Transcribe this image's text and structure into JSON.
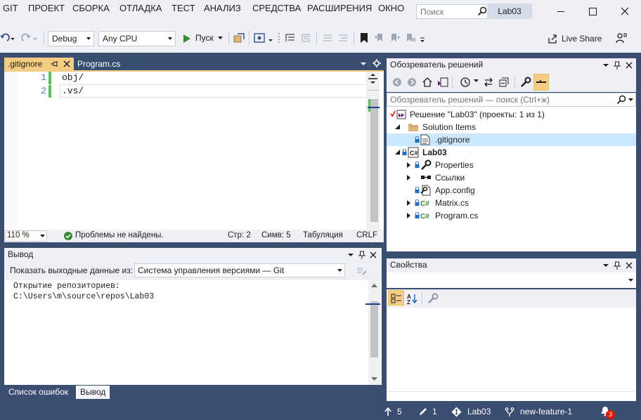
{
  "menu": {
    "items": [
      "GIT",
      "ПРОЕКТ",
      "СБОРКА",
      "ОТЛАДКА",
      "ТЕСТ",
      "АНАЛИЗ",
      "СРЕДСТВА",
      "РАСШИРЕНИЯ",
      "ОКНО"
    ],
    "search_placeholder": "Поиск",
    "solution_name": "Lab03"
  },
  "toolbar": {
    "configuration": "Debug",
    "platform": "Any CPU",
    "start_label": "Пуск",
    "live_share_label": "Live Share"
  },
  "editor": {
    "tabs": [
      {
        "label": ".gitignore",
        "active": true
      },
      {
        "label": "Program.cs",
        "active": false
      }
    ],
    "lines": [
      {
        "number": "1",
        "text": "obj/"
      },
      {
        "number": "2",
        "text": ".vs/"
      }
    ],
    "status": {
      "zoom": "110 %",
      "problems": "Проблемы не найдены.",
      "line": "Стр: 2",
      "column": "Симв: 5",
      "indent": "Табуляция",
      "line_ending": "CRLF"
    }
  },
  "output": {
    "title": "Вывод",
    "show_label": "Показать выходные данные из:",
    "source": "Система управления версиями — Git",
    "lines": [
      "Открытие репозиториев:",
      "C:\\Users\\m\\source\\repos\\Lab03"
    ],
    "bottom_tabs": [
      {
        "label": "Список ошибок",
        "active": false
      },
      {
        "label": "Вывод",
        "active": true
      }
    ]
  },
  "solution_explorer": {
    "title": "Обозреватель решений",
    "search_placeholder": "Обозреватель решений — поиск (Ctrl+ж)",
    "tree": {
      "solution": "Решение \"Lab03\" (проекты: 1 из 1)",
      "solution_items": "Solution Items",
      "gitignore": ".gitignore",
      "project": "Lab03",
      "properties": "Properties",
      "references": "Ссылки",
      "app_config": "App.config",
      "matrix_cs": "Matrix.cs",
      "program_cs": "Program.cs"
    }
  },
  "properties": {
    "title": "Свойства"
  },
  "statusbar": {
    "push_count": "5",
    "changes_count": "1",
    "repo": "Lab03",
    "branch": "new-feature-1",
    "notifications": "3"
  },
  "colors": {
    "chrome": "#3c4d72",
    "panel": "#eef0f6",
    "active_tab": "#f5cc84",
    "selection": "#cce8ff",
    "notification_badge": "#e51400",
    "change_bar": "#57c05b"
  }
}
